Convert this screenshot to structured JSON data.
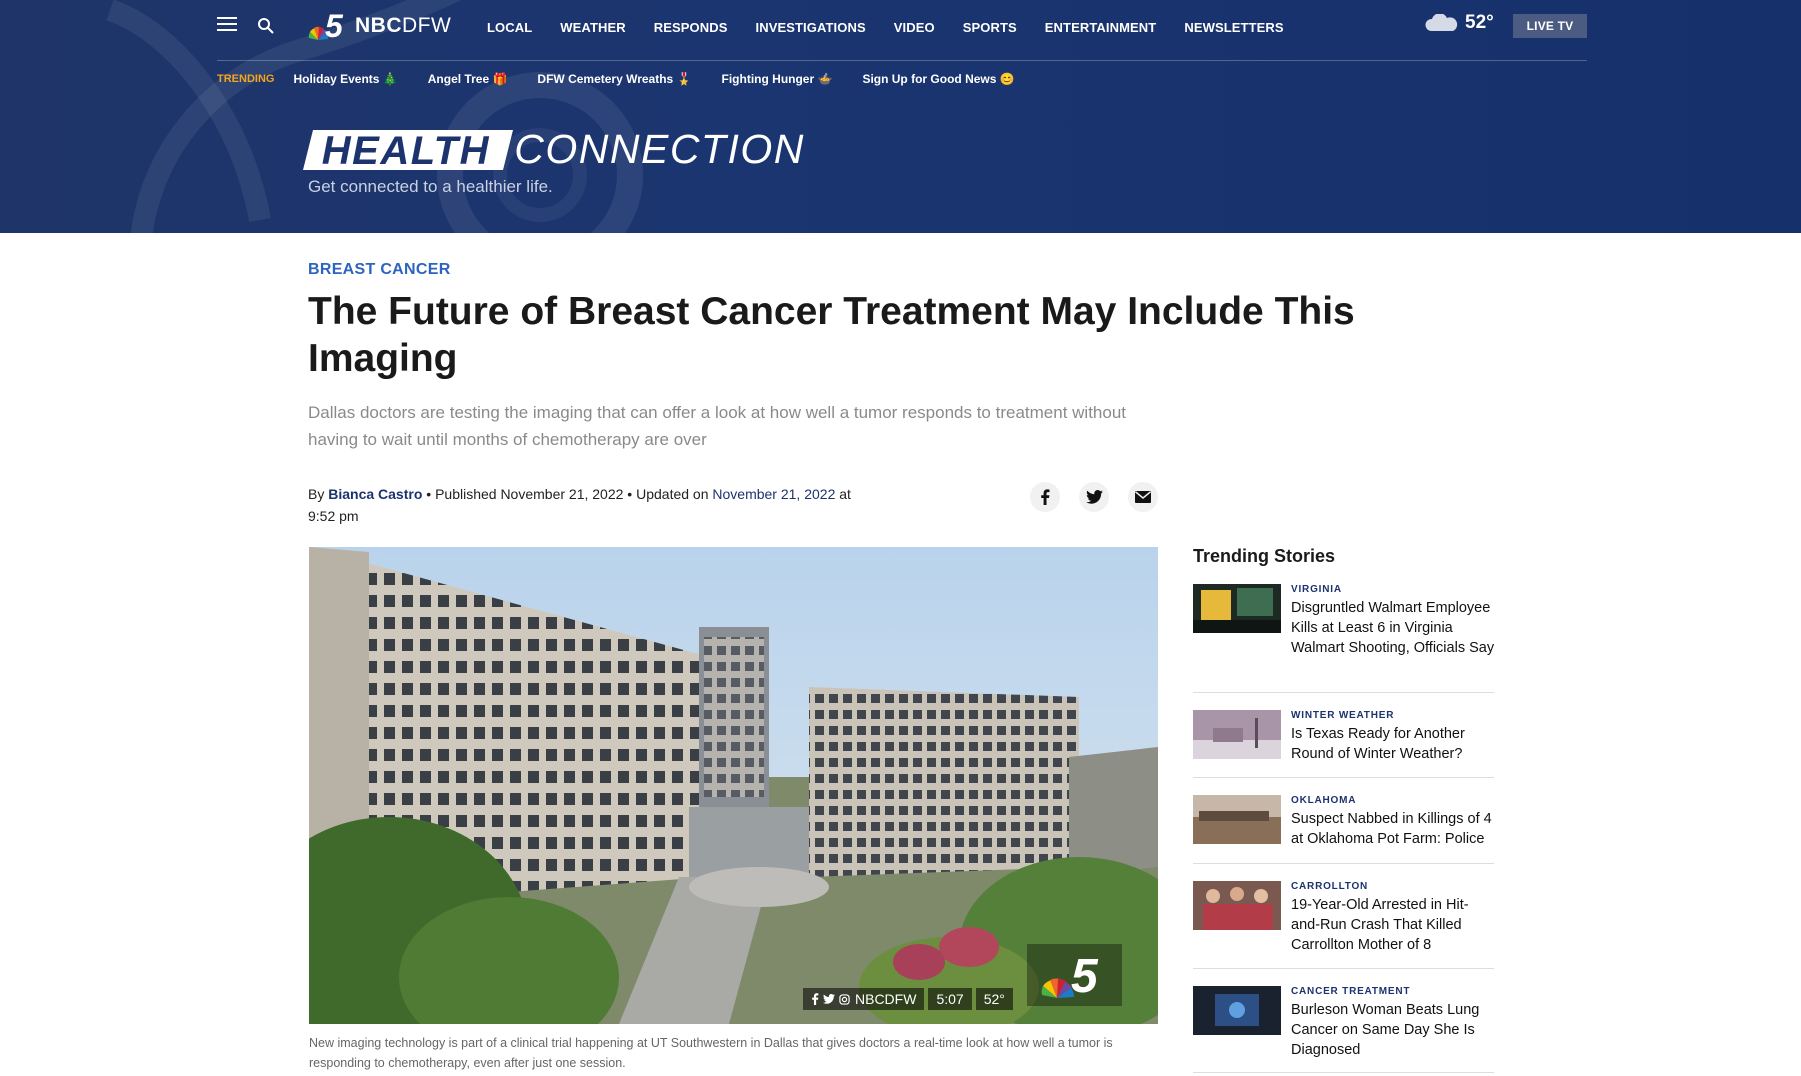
{
  "header": {
    "logo_text_bold": "NBC",
    "logo_text_light": "DFW",
    "nav": [
      "LOCAL",
      "WEATHER",
      "RESPONDS",
      "INVESTIGATIONS",
      "VIDEO",
      "SPORTS",
      "ENTERTAINMENT",
      "NEWSLETTERS"
    ],
    "temperature": "52°",
    "live_tv": "LIVE TV",
    "trending_label": "TRENDING",
    "trending_items": [
      "Holiday Events 🎄",
      "Angel Tree 🎁",
      "DFW Cemetery Wreaths 🎖️",
      "Fighting Hunger 🍲",
      "Sign Up for Good News 😊"
    ],
    "section_word1": "HEALTH",
    "section_word2": "CONNECTION",
    "tagline": "Get connected to a healthier life."
  },
  "article": {
    "category": "BREAST CANCER",
    "headline": "The Future of Breast Cancer Treatment May Include This Imaging",
    "dek": "Dallas doctors are testing the imaging that can offer a look at how well a tumor responds to treatment without having to wait until months of chemotherapy are over",
    "by_prefix": "By",
    "author": "Bianca Castro",
    "published_text": "• Published November 21, 2022 • Updated on",
    "updated_date": "November 21, 2022",
    "time_text": "at 9:52 pm",
    "video": {
      "social_handle": "NBCDFW",
      "clock": "5:07",
      "temp": "52°"
    },
    "caption": "New imaging technology is part of a clinical trial happening at UT Southwestern in Dallas that gives doctors a real-time look at how well a tumor is responding to chemotherapy, even after just one session."
  },
  "sidebar": {
    "title": "Trending Stories",
    "stories": [
      {
        "tag": "VIRGINIA",
        "title": "Disgruntled Walmart Employee Kills at Least 6 in Virginia Walmart Shooting, Officials Say"
      },
      {
        "tag": "WINTER WEATHER",
        "title": "Is Texas Ready for Another Round of Winter Weather?"
      },
      {
        "tag": "OKLAHOMA",
        "title": "Suspect Nabbed in Killings of 4 at Oklahoma Pot Farm: Police"
      },
      {
        "tag": "CARROLLTON",
        "title": "19-Year-Old Arrested in Hit-and-Run Crash That Killed Carrollton Mother of 8"
      },
      {
        "tag": "CANCER TREATMENT",
        "title": "Burleson Woman Beats Lung Cancer on Same Day She Is Diagnosed"
      }
    ]
  },
  "colors": {
    "header_bg": "#1b3570",
    "trending_label": "#f4a51c",
    "category": "#2c64bf",
    "link": "#1d336d"
  },
  "icons": [
    "menu-icon",
    "search-icon",
    "nbc-peacock-logo",
    "cloud-icon",
    "facebook-icon",
    "twitter-icon",
    "email-icon",
    "instagram-icon"
  ]
}
